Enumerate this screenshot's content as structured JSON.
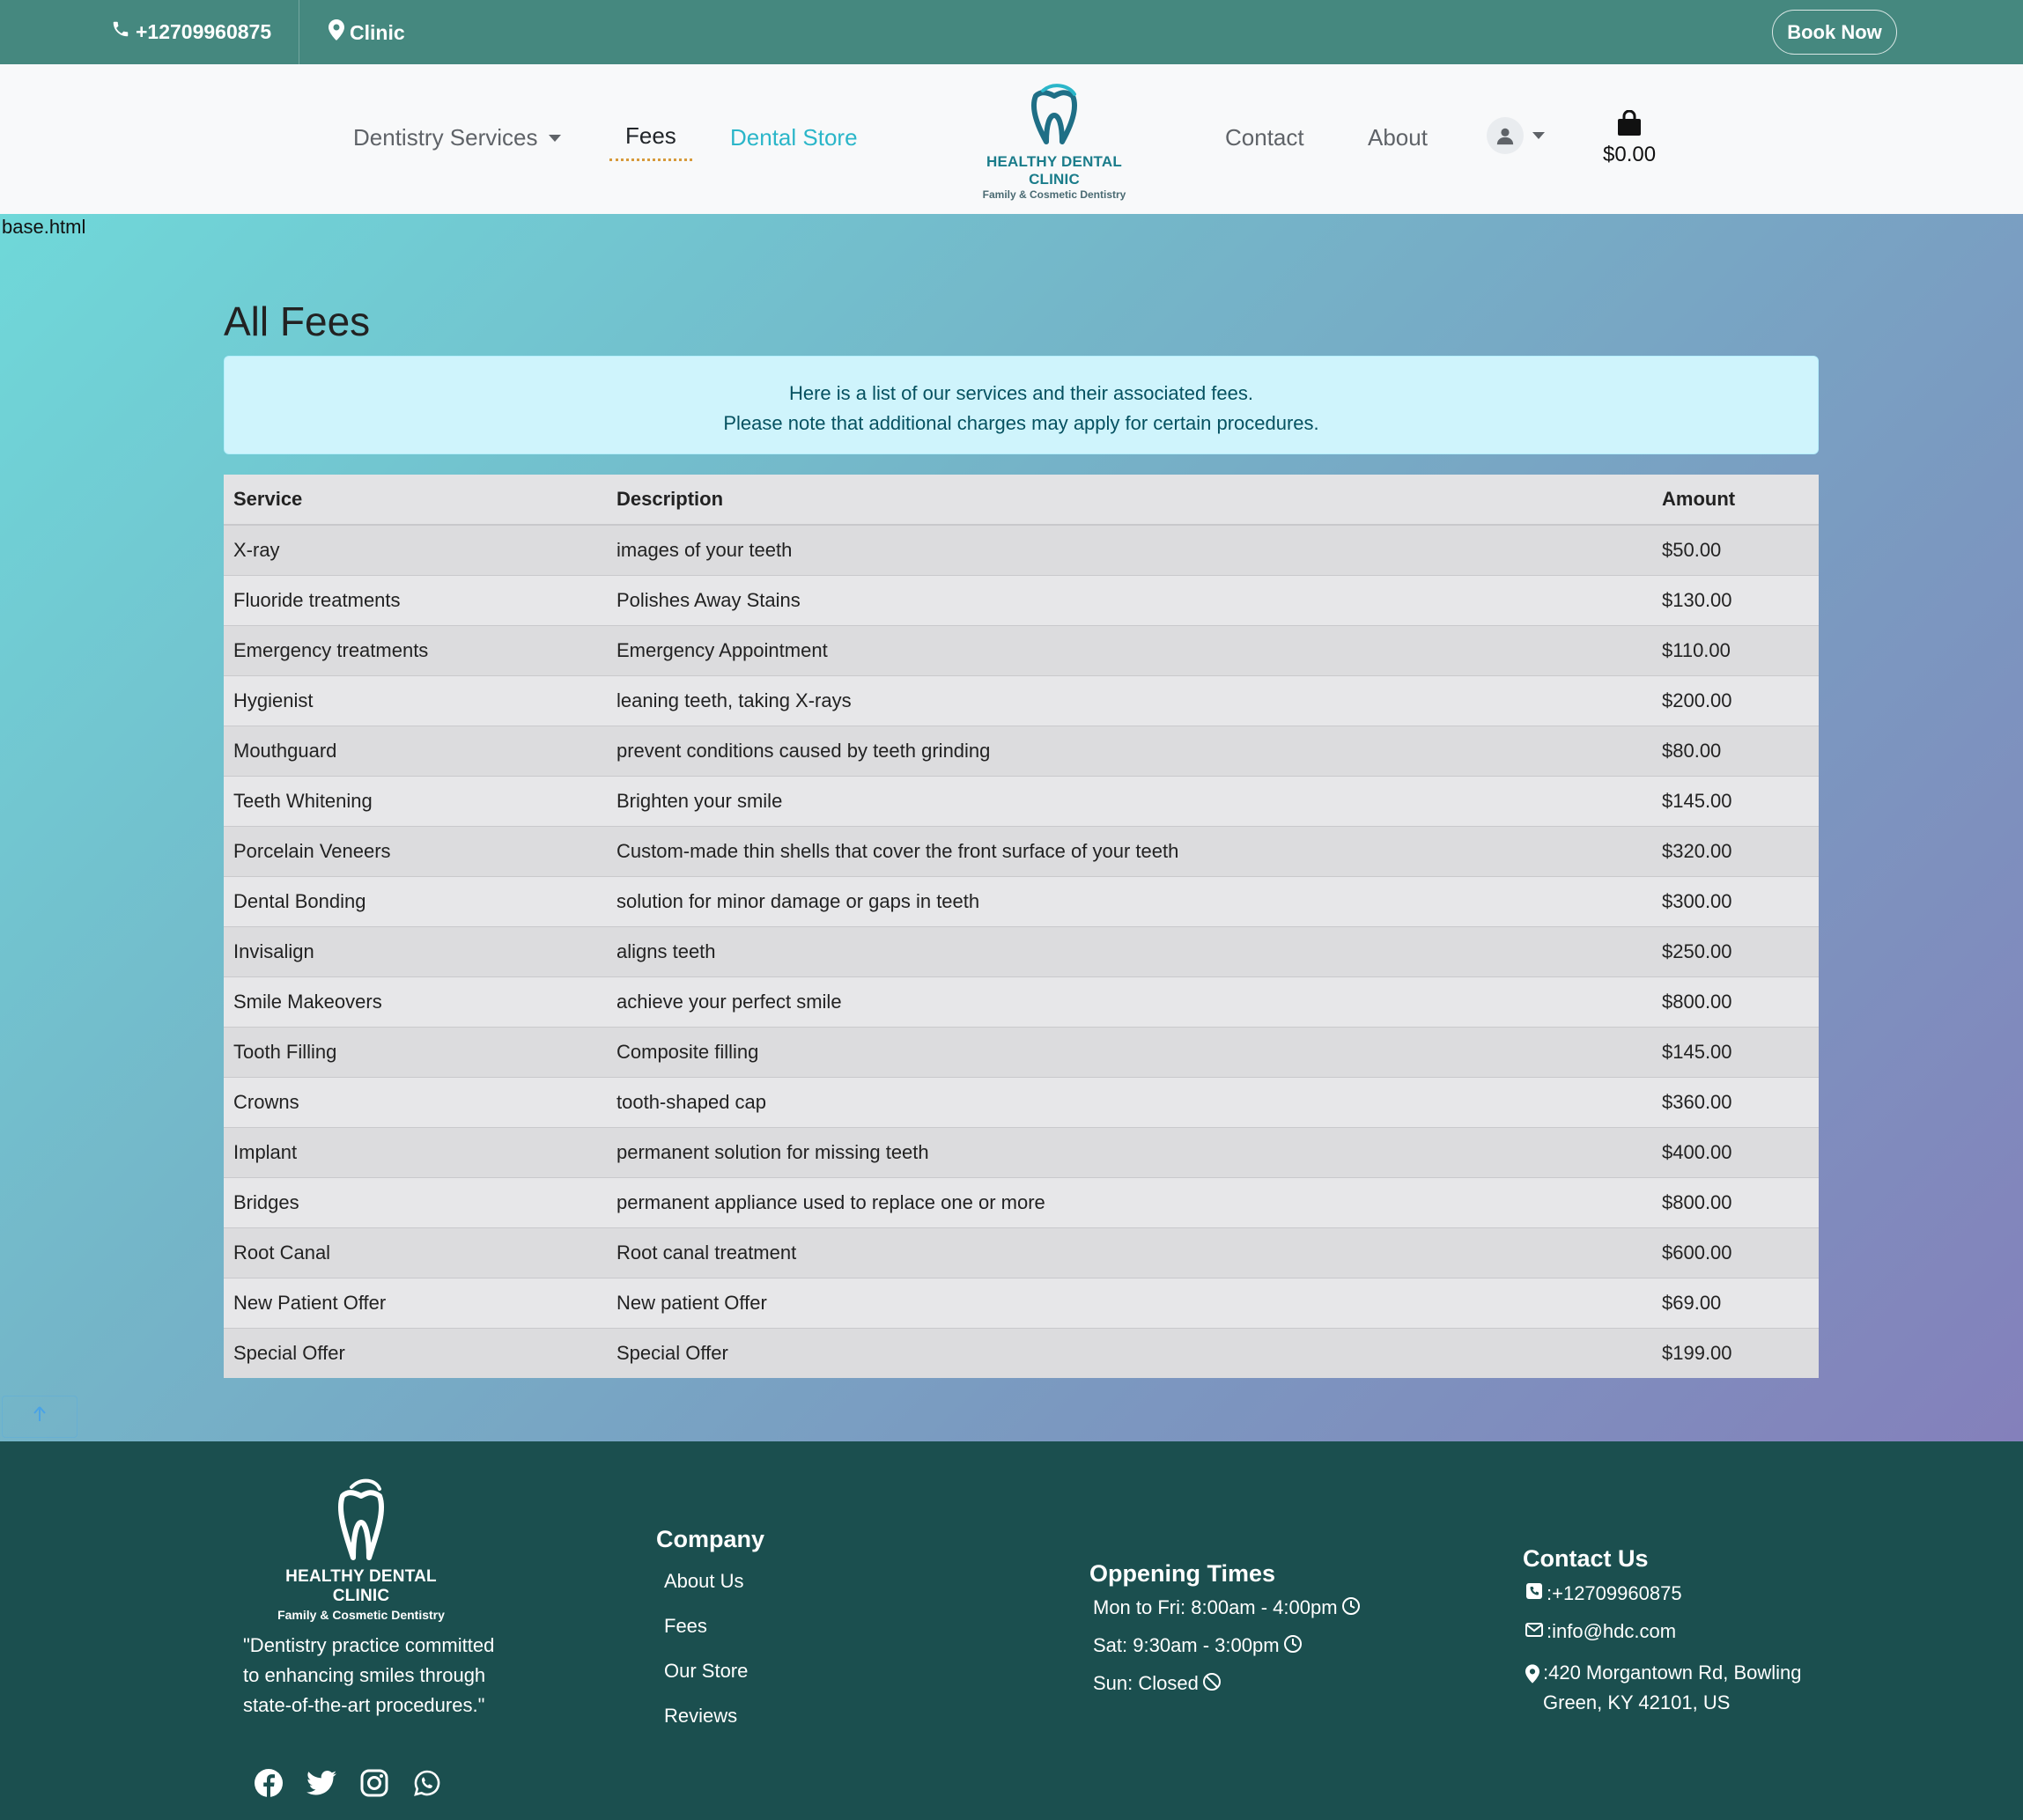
{
  "topbar": {
    "phone": "+12709960875",
    "location": "Clinic",
    "book_button": "Book Now"
  },
  "nav": {
    "services": "Dentistry Services",
    "fees": "Fees",
    "store": "Dental Store",
    "contact": "Contact",
    "about": "About",
    "cart_total": "$0.00",
    "active_item": "Fees",
    "accent_color": "#2bb6c9"
  },
  "logo": {
    "name": "HEALTHY DENTAL CLINIC",
    "tagline": "Family & Cosmetic Dentistry"
  },
  "main": {
    "file_label": "base.html",
    "title": "All Fees",
    "alert_line1": "Here is a list of our services and their associated fees.",
    "alert_line2": "Please note that additional charges may apply for certain procedures.",
    "table": {
      "headers": [
        "Service",
        "Description",
        "Amount"
      ],
      "rows": [
        [
          "X-ray",
          "images of your teeth",
          "$50.00"
        ],
        [
          "Fluoride treatments",
          "Polishes Away Stains",
          "$130.00"
        ],
        [
          "Emergency treatments",
          "Emergency Appointment",
          "$110.00"
        ],
        [
          "Hygienist",
          "leaning teeth, taking X-rays",
          "$200.00"
        ],
        [
          "Mouthguard",
          "prevent conditions caused by teeth grinding",
          "$80.00"
        ],
        [
          "Teeth Whitening",
          "Brighten your smile",
          "$145.00"
        ],
        [
          "Porcelain Veneers",
          "Custom-made thin shells that cover the front surface of your teeth",
          "$320.00"
        ],
        [
          "Dental Bonding",
          "solution for minor damage or gaps in teeth",
          "$300.00"
        ],
        [
          "Invisalign",
          "aligns teeth",
          "$250.00"
        ],
        [
          "Smile Makeovers",
          "achieve your perfect smile",
          "$800.00"
        ],
        [
          "Tooth Filling",
          "Composite filling",
          "$145.00"
        ],
        [
          "Crowns",
          "tooth-shaped cap",
          "$360.00"
        ],
        [
          "Implant",
          "permanent solution for missing teeth",
          "$400.00"
        ],
        [
          "Bridges",
          "permanent appliance used to replace one or more",
          "$800.00"
        ],
        [
          "Root Canal",
          "Root canal treatment",
          "$600.00"
        ],
        [
          "New Patient Offer",
          "New patient Offer",
          "$69.00"
        ],
        [
          "Special Offer",
          "Special Offer",
          "$199.00"
        ]
      ]
    }
  },
  "footer": {
    "quote": "\"Dentistry practice committed to enhancing smiles through state-of-the-art procedures.\"",
    "company_title": "Company",
    "company_links": [
      "About Us",
      "Fees",
      "Our Store",
      "Reviews"
    ],
    "hours_title": "Oppening Times",
    "hours": [
      "Mon to Fri: 8:00am - 4:00pm",
      "Sat: 9:30am - 3:00pm",
      "Sun: Closed"
    ],
    "contact_title": "Contact Us",
    "contact_phone": ":+12709960875",
    "contact_email": ":info@hdc.com",
    "contact_address": ":420 Morgantown Rd, Bowling Green, KY 42101, US",
    "social_icons": [
      "facebook-icon",
      "twitter-icon",
      "instagram-icon",
      "whatsapp-icon"
    ]
  }
}
